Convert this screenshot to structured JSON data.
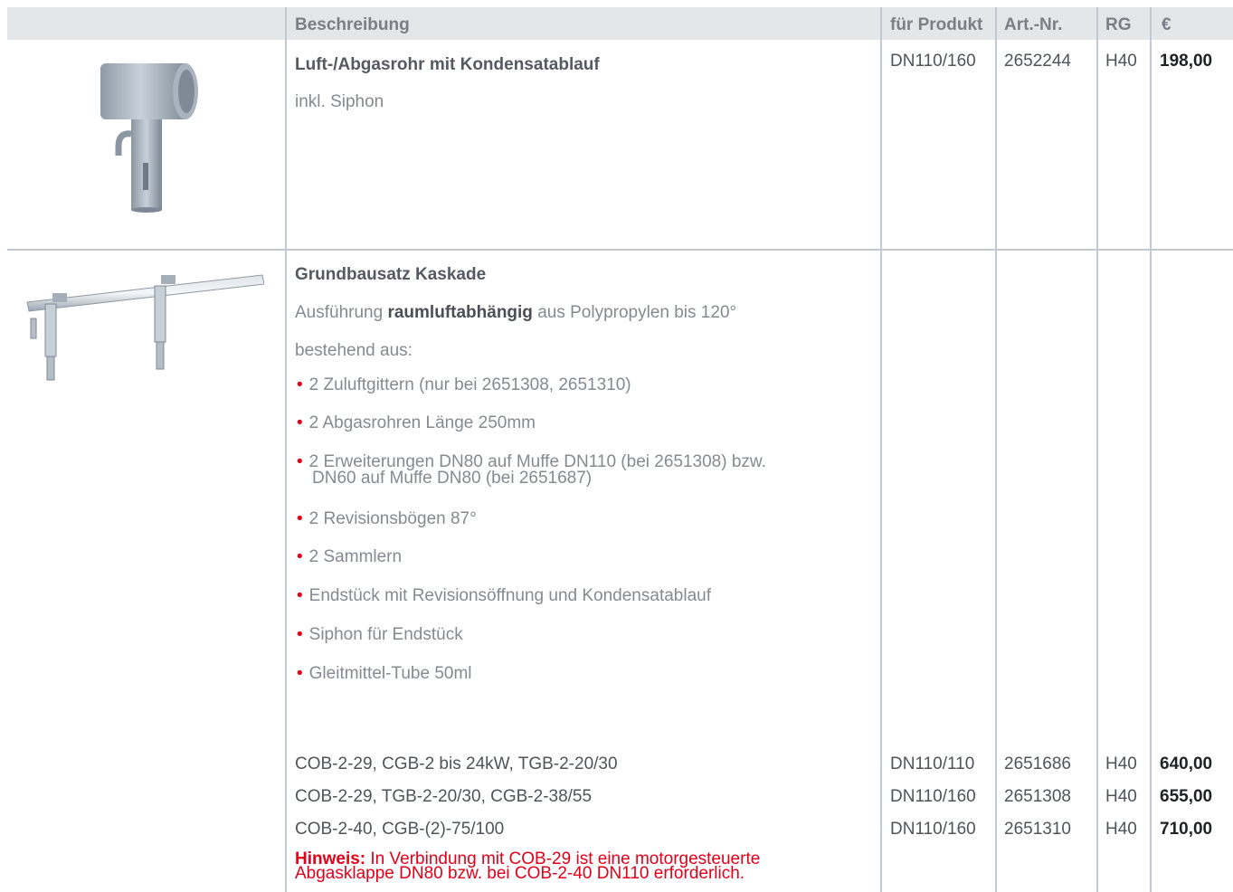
{
  "header": {
    "col_desc": "Beschreibung",
    "col_product": "für Produkt",
    "col_artnr": "Art.-Nr.",
    "col_rg": "RG",
    "col_price": "€"
  },
  "items": [
    {
      "title": "Luft-/Abgasrohr mit Kondensatablauf",
      "subtitle": "inkl. Siphon",
      "product": "DN110/160",
      "artnr": "2652244",
      "rg": "H40",
      "price": "198,00"
    },
    {
      "title": "Grundbausatz Kaskade",
      "line1_pre": "Ausführung",
      "line1_bold": "raumluftabhängig",
      "line1_post": "aus Polypropylen bis 120°",
      "line2": "bestehend aus:",
      "bullets": [
        "2 Zuluftgittern (nur bei 2651308, 2651310)",
        "2 Abgasrohren Länge 250mm",
        "2 Erweiterungen DN80 auf Muffe DN110 (bei 2651308) bzw.",
        "DN60 auf Muffe DN80 (bei 2651687)",
        "2 Revisionsbögen 87°",
        "2 Sammlern",
        "Endstück mit Revisionsöffnung und Kondensatablauf",
        "Siphon für Endstück",
        "Gleitmittel-Tube 50ml"
      ],
      "variants": [
        {
          "desc": "COB-2-29, CGB-2 bis 24kW, TGB-2-20/30",
          "product": "DN110/110",
          "artnr": "2651686",
          "rg": "H40",
          "price": "640,00"
        },
        {
          "desc": "COB-2-29, TGB-2-20/30, CGB-2-38/55",
          "product": "DN110/160",
          "artnr": "2651308",
          "rg": "H40",
          "price": "655,00"
        },
        {
          "desc": "COB-2-40, CGB-(2)-75/100",
          "product": "DN110/160",
          "artnr": "2651310",
          "rg": "H40",
          "price": "710,00"
        }
      ],
      "note_label": "Hinweis:",
      "note_line1": "In Verbindung mit COB-29 ist eine motorgesteuerte",
      "note_line2": "Abgasklappe DN80 bzw. bei COB-2-40 DN110 erforderlich."
    }
  ],
  "colors": {
    "accent_red": "#e2001a",
    "header_bg": "#e4e7ea",
    "rule": "#c3c9d0"
  }
}
